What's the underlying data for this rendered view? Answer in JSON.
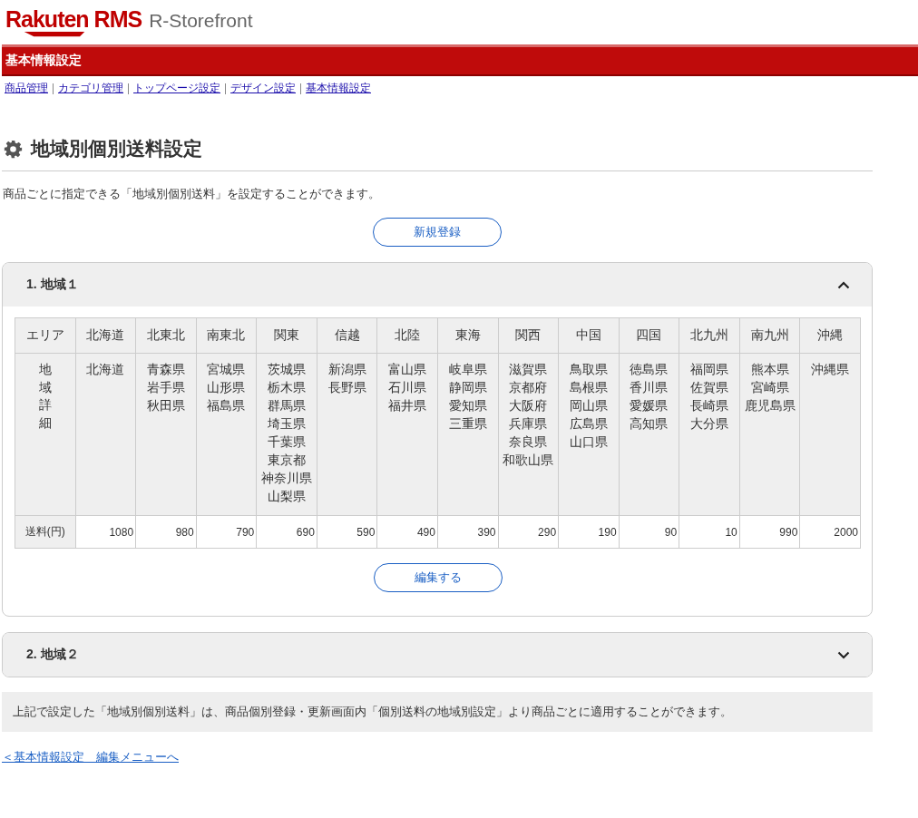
{
  "logo": {
    "brand": "Rakuten RMS",
    "product": "R-Storefront"
  },
  "section_bar": {
    "title": "基本情報設定"
  },
  "nav_links": [
    {
      "label": "商品管理"
    },
    {
      "label": "カテゴリ管理"
    },
    {
      "label": "トップページ設定"
    },
    {
      "label": "デザイン設定"
    },
    {
      "label": "基本情報設定"
    }
  ],
  "page_title": "地域別個別送料設定",
  "description": "商品ごとに指定できる「地域別個別送料」を設定することができます。",
  "new_button": "新規登録",
  "regions": [
    {
      "title": "1. 地域１",
      "expanded": true,
      "table": {
        "header_label": "エリア",
        "detail_label": "地域詳細",
        "fee_label": "送料(円)",
        "areas": [
          {
            "name": "北海道",
            "prefectures": [
              "北海道"
            ],
            "fee": "1080"
          },
          {
            "name": "北東北",
            "prefectures": [
              "青森県",
              "岩手県",
              "秋田県"
            ],
            "fee": "980"
          },
          {
            "name": "南東北",
            "prefectures": [
              "宮城県",
              "山形県",
              "福島県"
            ],
            "fee": "790"
          },
          {
            "name": "関東",
            "prefectures": [
              "茨城県",
              "栃木県",
              "群馬県",
              "埼玉県",
              "千葉県",
              "東京都",
              "神奈川県",
              "山梨県"
            ],
            "fee": "690"
          },
          {
            "name": "信越",
            "prefectures": [
              "新潟県",
              "長野県"
            ],
            "fee": "590"
          },
          {
            "name": "北陸",
            "prefectures": [
              "富山県",
              "石川県",
              "福井県"
            ],
            "fee": "490"
          },
          {
            "name": "東海",
            "prefectures": [
              "岐阜県",
              "静岡県",
              "愛知県",
              "三重県"
            ],
            "fee": "390"
          },
          {
            "name": "関西",
            "prefectures": [
              "滋賀県",
              "京都府",
              "大阪府",
              "兵庫県",
              "奈良県",
              "和歌山県"
            ],
            "fee": "290"
          },
          {
            "name": "中国",
            "prefectures": [
              "鳥取県",
              "島根県",
              "岡山県",
              "広島県",
              "山口県"
            ],
            "fee": "190"
          },
          {
            "name": "四国",
            "prefectures": [
              "徳島県",
              "香川県",
              "愛媛県",
              "高知県"
            ],
            "fee": "90"
          },
          {
            "name": "北九州",
            "prefectures": [
              "福岡県",
              "佐賀県",
              "長崎県",
              "大分県"
            ],
            "fee": "10"
          },
          {
            "name": "南九州",
            "prefectures": [
              "熊本県",
              "宮崎県",
              "鹿児島県"
            ],
            "fee": "990"
          },
          {
            "name": "沖縄",
            "prefectures": [
              "沖縄県"
            ],
            "fee": "2000"
          }
        ]
      },
      "edit_button": "編集する"
    },
    {
      "title": "2. 地域２",
      "expanded": false
    }
  ],
  "note": "上記で設定した「地域別個別送料」は、商品個別登録・更新画面内「個別送料の地域別設定」より商品ごとに適用することができます。",
  "back_link": "＜基本情報設定　編集メニューへ"
}
